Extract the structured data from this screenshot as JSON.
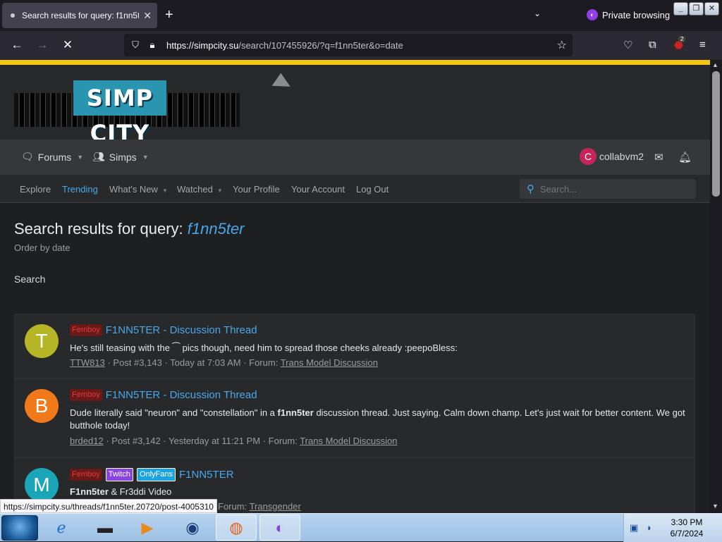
{
  "browser": {
    "tab_title": "Search results for query: f1nn5t",
    "private_label": "Private browsing",
    "url_host": "https://simpcity.su",
    "url_path": "/search/107455926/?q=f1nn5ter&o=date",
    "badge_count": "2"
  },
  "site": {
    "logo_text": "SIMP CITY",
    "nav": {
      "forums": "Forums",
      "simps": "Simps",
      "user_initial": "C",
      "username": "collabvm2"
    },
    "subnav": {
      "explore": "Explore",
      "trending": "Trending",
      "whats_new": "What's New",
      "watched": "Watched",
      "your_profile": "Your Profile",
      "your_account": "Your Account",
      "log_out": "Log Out"
    },
    "search_placeholder": "Search..."
  },
  "page": {
    "title_prefix": "Search results for query: ",
    "query": "f1nn5ter",
    "order": "Order by date",
    "search_label": "Search"
  },
  "results": [
    {
      "avatar_letter": "T",
      "avatar_color": "#b5b525",
      "tags": [
        "Femboy"
      ],
      "title": "F1NN5TER - Discussion Thread",
      "snippet": "He's still teasing with the ⁀ pics though, need him to spread those cheeks already :peepoBless:",
      "author": "TTW813",
      "post": "Post #3,143",
      "time": "Today at 7:03 AM",
      "forum_label": "Forum:",
      "forum": "Trans Model Discussion"
    },
    {
      "avatar_letter": "B",
      "avatar_color": "#f07a1a",
      "tags": [
        "Femboy"
      ],
      "title": "F1NN5TER - Discussion Thread",
      "snippet_pre": "Dude literally said \"neuron\" and \"constellation\" in a ",
      "snippet_bold": "f1nn5ter",
      "snippet_post": " discussion thread. Just saying. Calm down champ. Let's just wait for better content. We got butthole today!",
      "author": "brded12",
      "post": "Post #3,142",
      "time": "Yesterday at 11:21 PM",
      "forum_label": "Forum:",
      "forum": "Trans Model Discussion"
    },
    {
      "avatar_letter": "M",
      "avatar_color": "#1aa5b8",
      "tags": [
        "Femboy",
        "Twitch",
        "OnlyFans"
      ],
      "title": "F1NN5TER",
      "snippet_bold": "F1nn5ter",
      "snippet_post": " & Fr3ddi Video",
      "forum_label": "Forum:",
      "forum": "Transgender"
    }
  ],
  "status_url": "https://simpcity.su/threads/f1nn5ter.20720/post-4005310",
  "taskbar": {
    "time": "3:30 PM",
    "date": "6/7/2024"
  },
  "colors": {
    "accent_bar": "#f2c611",
    "link": "#47a7eb",
    "user_avatar": "#c7255a"
  },
  "icons": [
    "private-mask-icon",
    "back-arrow-icon",
    "forward-arrow-icon",
    "stop-icon",
    "shield-icon",
    "lock-icon",
    "star-icon",
    "pocket-icon",
    "extensions-icon",
    "ublock-icon",
    "menu-icon",
    "forums-icon",
    "simps-icon",
    "mail-icon",
    "bell-icon",
    "search-icon"
  ]
}
